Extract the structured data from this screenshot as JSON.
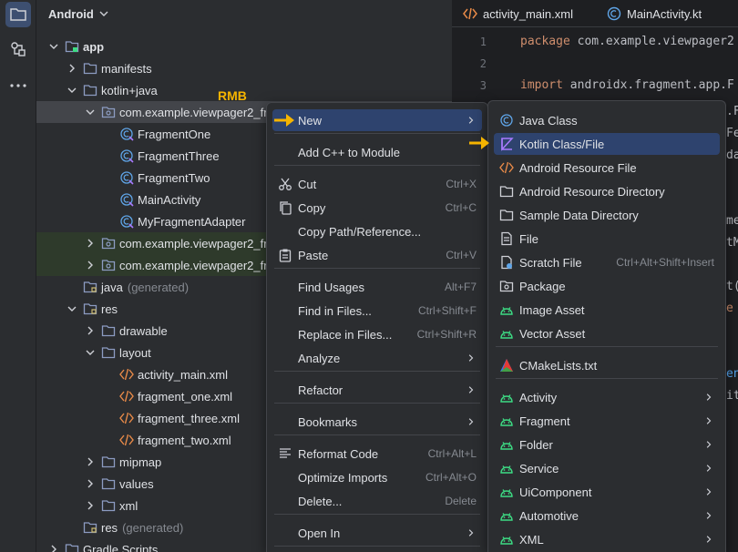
{
  "project_panel": {
    "view_selector": "Android",
    "tree": [
      {
        "label": "app",
        "bold": true
      },
      {
        "label": "manifests"
      },
      {
        "label": "kotlin+java"
      },
      {
        "label": "com.example.viewpager2_frag"
      },
      {
        "label": "FragmentOne"
      },
      {
        "label": "FragmentThree"
      },
      {
        "label": "FragmentTwo"
      },
      {
        "label": "MainActivity"
      },
      {
        "label": "MyFragmentAdapter"
      },
      {
        "label": "com.example.viewpager2_frag"
      },
      {
        "label": "com.example.viewpager2_frag"
      },
      {
        "label": "java",
        "suffix": "(generated)"
      },
      {
        "label": "res"
      },
      {
        "label": "drawable"
      },
      {
        "label": "layout"
      },
      {
        "label": "activity_main.xml"
      },
      {
        "label": "fragment_one.xml"
      },
      {
        "label": "fragment_three.xml"
      },
      {
        "label": "fragment_two.xml"
      },
      {
        "label": "mipmap"
      },
      {
        "label": "values"
      },
      {
        "label": "xml"
      },
      {
        "label": "res",
        "suffix": "(generated)"
      },
      {
        "label": "Gradle Scripts"
      }
    ]
  },
  "annotation": "RMB",
  "editor": {
    "tabs": [
      "activity_main.xml",
      "MainActivity.kt"
    ],
    "line_numbers": [
      "1",
      "2",
      "3"
    ],
    "code_lines": [
      {
        "kw": "package",
        "text": " com.example.viewpager2"
      },
      {
        "kw": "import",
        "text": " androidx.fragment.app.F"
      }
    ],
    "peek": [
      ".F",
      "Fe",
      "da",
      "me",
      "tM",
      "t(",
      "e",
      "en",
      "it"
    ]
  },
  "context_menu": {
    "items": [
      {
        "label": "New",
        "shortcut": "",
        "submenu": true
      },
      {
        "label": "Add C++ to Module",
        "shortcut": ""
      },
      {
        "label": "Cut",
        "shortcut": "Ctrl+X"
      },
      {
        "label": "Copy",
        "shortcut": "Ctrl+C"
      },
      {
        "label": "Copy Path/Reference...",
        "shortcut": ""
      },
      {
        "label": "Paste",
        "shortcut": "Ctrl+V"
      },
      {
        "label": "Find Usages",
        "shortcut": "Alt+F7"
      },
      {
        "label": "Find in Files...",
        "shortcut": "Ctrl+Shift+F"
      },
      {
        "label": "Replace in Files...",
        "shortcut": "Ctrl+Shift+R"
      },
      {
        "label": "Analyze",
        "shortcut": "",
        "submenu": true
      },
      {
        "label": "Refactor",
        "shortcut": "",
        "submenu": true
      },
      {
        "label": "Bookmarks",
        "shortcut": "",
        "submenu": true
      },
      {
        "label": "Reformat Code",
        "shortcut": "Ctrl+Alt+L"
      },
      {
        "label": "Optimize Imports",
        "shortcut": "Ctrl+Alt+O"
      },
      {
        "label": "Delete...",
        "shortcut": "Delete"
      },
      {
        "label": "Open In",
        "shortcut": "",
        "submenu": true
      }
    ]
  },
  "new_submenu": {
    "items": [
      {
        "label": "Java Class",
        "shortcut": ""
      },
      {
        "label": "Kotlin Class/File",
        "shortcut": ""
      },
      {
        "label": "Android Resource File",
        "shortcut": ""
      },
      {
        "label": "Android Resource Directory",
        "shortcut": ""
      },
      {
        "label": "Sample Data Directory",
        "shortcut": ""
      },
      {
        "label": "File",
        "shortcut": ""
      },
      {
        "label": "Scratch File",
        "shortcut": "Ctrl+Alt+Shift+Insert"
      },
      {
        "label": "Package",
        "shortcut": ""
      },
      {
        "label": "Image Asset",
        "shortcut": ""
      },
      {
        "label": "Vector Asset",
        "shortcut": ""
      },
      {
        "label": "CMakeLists.txt",
        "shortcut": ""
      },
      {
        "label": "Activity",
        "shortcut": "",
        "submenu": true
      },
      {
        "label": "Fragment",
        "shortcut": "",
        "submenu": true
      },
      {
        "label": "Folder",
        "shortcut": "",
        "submenu": true
      },
      {
        "label": "Service",
        "shortcut": "",
        "submenu": true
      },
      {
        "label": "UiComponent",
        "shortcut": "",
        "submenu": true
      },
      {
        "label": "Automotive",
        "shortcut": "",
        "submenu": true
      },
      {
        "label": "XML",
        "shortcut": "",
        "submenu": true
      }
    ]
  },
  "colors": {
    "accent": "#2e436e",
    "arrow": "#f5b400",
    "android_green": "#3ddc84",
    "kotlin": "#a97bff",
    "folder": "#7b8bb0"
  }
}
